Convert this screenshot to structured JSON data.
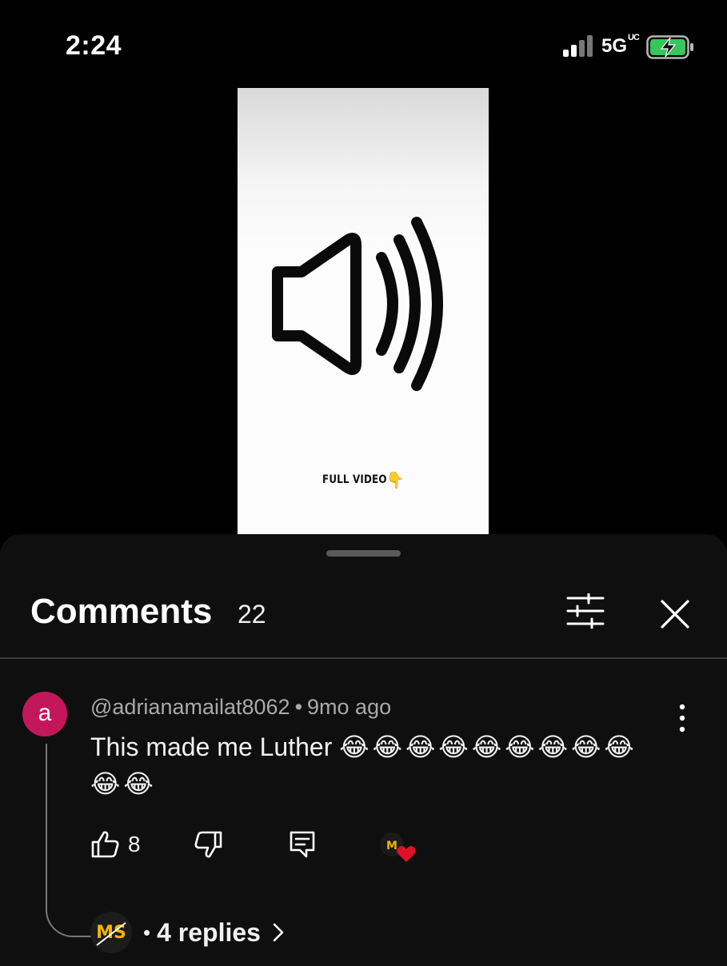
{
  "status_bar": {
    "time": "2:24",
    "network": "5G",
    "network_suffix": "UC",
    "signal_bars": 2,
    "battery_charging": true
  },
  "video": {
    "caption": "FULL VIDEO",
    "caption_emoji": "👇"
  },
  "comments": {
    "title": "Comments",
    "count": "22"
  },
  "comment": {
    "avatar_letter": "a",
    "avatar_color": "#c2185b",
    "author": "@adrianamailat8062",
    "separator": "•",
    "time_ago": "9mo ago",
    "text": "This made me Luther",
    "emojis": "😂😂😂😂😂😂😂😂😂😂😂",
    "like_count": "8"
  },
  "replies": {
    "separator": "•",
    "label": "4 replies",
    "avatar_initials": "MS"
  }
}
